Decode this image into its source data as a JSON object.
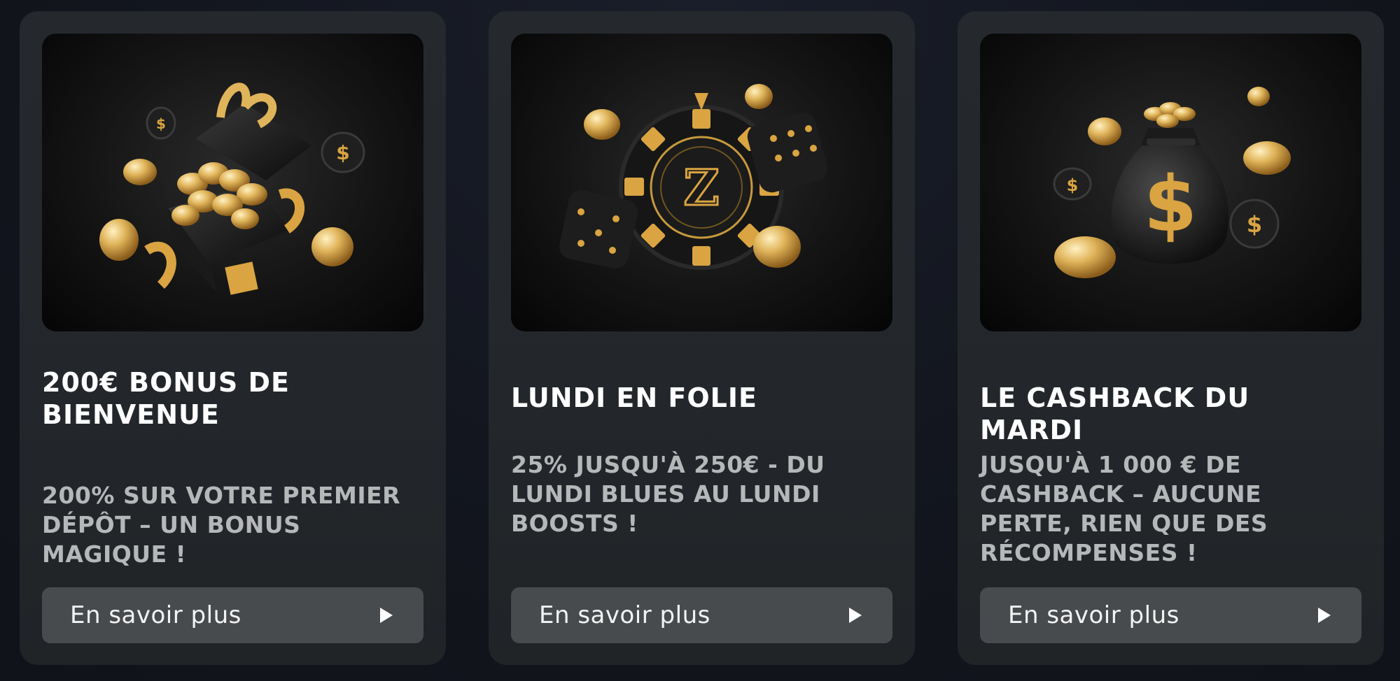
{
  "promotions": [
    {
      "title": "200€ BONUS DE BIENVENUE",
      "description": "200% SUR VOTRE PREMIER DÉPÔT – UN BONUS MAGIQUE !",
      "button_label": "En savoir plus",
      "image": "gift-box-with-gold-coins"
    },
    {
      "title": "LUNDI EN FOLIE",
      "description": "25% JUSQU'À 250€ - DU LUNDI BLUES AU LUNDI BOOSTS !",
      "button_label": "En savoir plus",
      "image": "casino-chip-with-dice-and-coins"
    },
    {
      "title": "LE CASHBACK DU MARDI",
      "description": "JUSQU'À 1 000 € DE CASHBACK – AUCUNE PERTE, RIEN QUE DES RÉCOMPENSES !",
      "button_label": "En savoir plus",
      "image": "money-bag-with-gold-coins"
    }
  ],
  "icons": {
    "button": "play-icon"
  },
  "colors": {
    "page_background": "#13161f",
    "card_background": "#24282c",
    "button_background": "#484b4e",
    "title_text": "#ffffff",
    "description_text": "#b5b7b9",
    "gold": "#d4a53a"
  }
}
